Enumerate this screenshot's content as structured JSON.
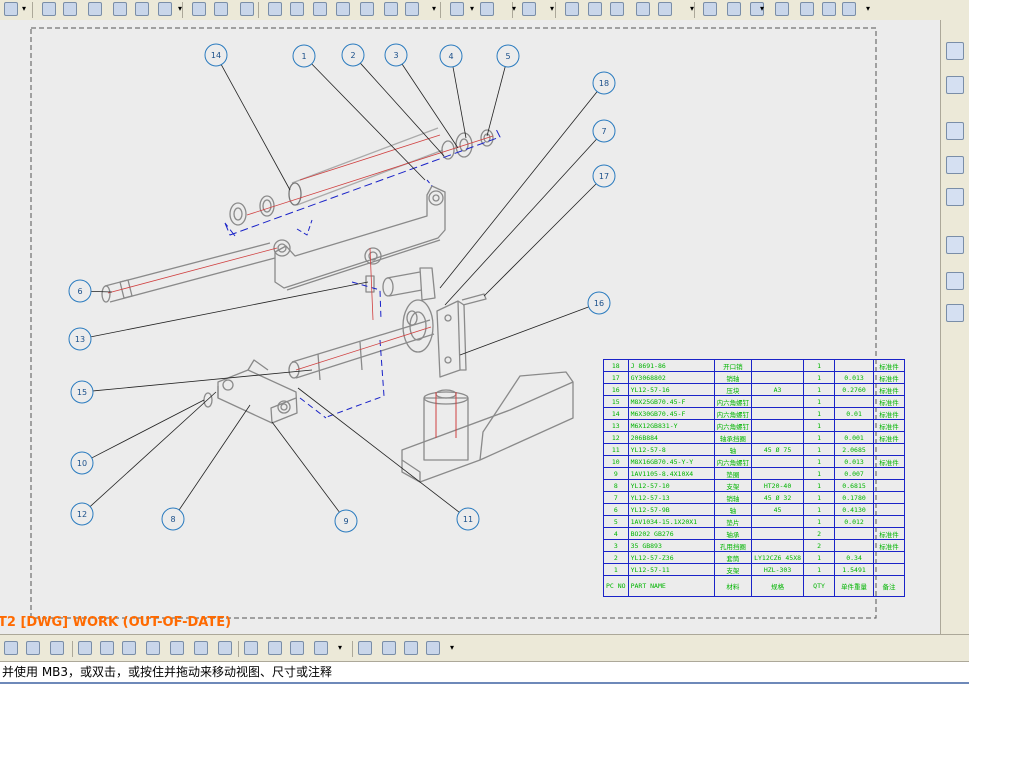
{
  "window": {
    "drawing_status": "T2 [DWG] WORK (OUT-OF-DATE)",
    "status_message": "并使用 MB3，或双击，或按住并拖动来移动视图、尺寸或注释"
  },
  "balloons": [
    "14",
    "1",
    "2",
    "3",
    "4",
    "5",
    "18",
    "7",
    "17",
    "16",
    "6",
    "13",
    "15",
    "10",
    "12",
    "8",
    "9",
    "11"
  ],
  "bom": {
    "header": [
      "PC NO",
      "PART NAME",
      "材料",
      "规格",
      "QTY",
      "单件重量",
      "备注"
    ],
    "rows": [
      [
        "18",
        "J 8691-86",
        "开口销",
        "",
        "1",
        "",
        "标准件"
      ],
      [
        "17",
        "GY3068802",
        "销轴",
        "",
        "1",
        "0.013",
        "标准件"
      ],
      [
        "16",
        "YL12-57-16",
        "压块",
        "A3",
        "1",
        "0.2760",
        "标准件"
      ],
      [
        "15",
        "M8X25GB70.45-F",
        "内六角螺钉",
        "",
        "1",
        "",
        "标准件"
      ],
      [
        "14",
        "M6X30GB70.45-F",
        "内六角螺钉",
        "",
        "1",
        "0.01",
        "标准件"
      ],
      [
        "13",
        "M6X12GB831-Y",
        "内六角螺钉",
        "",
        "1",
        "",
        "标准件"
      ],
      [
        "12",
        "206B884",
        "轴承挡圈",
        "",
        "1",
        "0.001",
        "标准件"
      ],
      [
        "11",
        "YL12-57-8",
        "轴",
        "45 Ø 75",
        "1",
        "2.0685",
        ""
      ],
      [
        "10",
        "M8X16GB70.45-Y-Y",
        "内六角螺钉",
        "",
        "1",
        "0.013",
        "标准件"
      ],
      [
        "9",
        "1AV1105-8.4X10X4",
        "垫圈",
        "",
        "1",
        "0.007",
        ""
      ],
      [
        "8",
        "YL12-57-10",
        "支架",
        "HT20-40",
        "1",
        "0.6815",
        ""
      ],
      [
        "7",
        "YL12-57-13",
        "销轴",
        "45 Ø 32",
        "1",
        "0.1780",
        ""
      ],
      [
        "6",
        "YL12-57-9B",
        "轴",
        "45",
        "1",
        "0.4130",
        ""
      ],
      [
        "5",
        "1AV1034-15.1X20X1",
        "垫片",
        "",
        "1",
        "0.012",
        ""
      ],
      [
        "4",
        "BO202 GB276",
        "轴承",
        "",
        "2",
        "",
        "标准件"
      ],
      [
        "3",
        "35 GB893",
        "孔用挡圈",
        "",
        "2",
        "",
        "标准件"
      ],
      [
        "2",
        "YL12-57-Z36",
        "套筒",
        "LY12CZ6 45X8",
        "1",
        "0.34",
        ""
      ],
      [
        "1",
        "YL12-57-11",
        "支架",
        "HZL-303",
        "1",
        "1.5491",
        ""
      ]
    ]
  },
  "icons": {
    "top_toolbar": [
      "new-icon",
      "open-icon",
      "save-icon",
      "cut-icon",
      "copy-icon",
      "paste-icon",
      "undo-icon",
      "redo-icon",
      "refresh-icon",
      "view-icon",
      "fit-icon",
      "zoom-icon",
      "pan-icon",
      "rotate-icon",
      "select-icon",
      "dimension-icon",
      "line-icon",
      "point-icon",
      "table-icon",
      "text-icon",
      "note-icon",
      "symbol-icon",
      "format-icon",
      "label-icon",
      "measure-icon",
      "flag-icon",
      "hatch-icon"
    ],
    "right_toolbar": [
      "assembly-navigator-icon",
      "part-navigator-icon",
      "web-browser-icon",
      "history-icon",
      "help-icon",
      "clock-icon",
      "palette-icon",
      "roles-icon"
    ],
    "bottom_toolbar": [
      "layer-icon",
      "layer-settings-icon",
      "layer-visible-icon",
      "wireframe-icon",
      "sketch-icon",
      "curve-icon",
      "spline-icon",
      "offset-icon",
      "trim-icon",
      "analysis-icon",
      "check-icon",
      "model-icon",
      "view-edit-icon",
      "section-icon",
      "detail-icon",
      "break-icon"
    ]
  }
}
